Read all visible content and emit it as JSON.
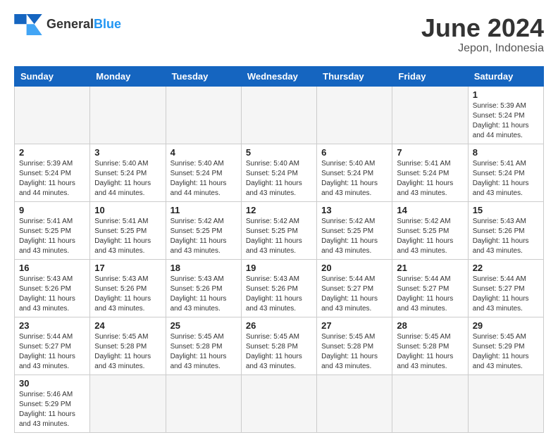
{
  "header": {
    "logo_general": "General",
    "logo_blue": "Blue",
    "month": "June 2024",
    "location": "Jepon, Indonesia"
  },
  "weekdays": [
    "Sunday",
    "Monday",
    "Tuesday",
    "Wednesday",
    "Thursday",
    "Friday",
    "Saturday"
  ],
  "weeks": [
    [
      {
        "day": "",
        "empty": true
      },
      {
        "day": "",
        "empty": true
      },
      {
        "day": "",
        "empty": true
      },
      {
        "day": "",
        "empty": true
      },
      {
        "day": "",
        "empty": true
      },
      {
        "day": "",
        "empty": true
      },
      {
        "day": "1",
        "info": "Sunrise: 5:39 AM\nSunset: 5:24 PM\nDaylight: 11 hours and 44 minutes."
      }
    ],
    [
      {
        "day": "2",
        "info": "Sunrise: 5:39 AM\nSunset: 5:24 PM\nDaylight: 11 hours and 44 minutes."
      },
      {
        "day": "3",
        "info": "Sunrise: 5:40 AM\nSunset: 5:24 PM\nDaylight: 11 hours and 44 minutes."
      },
      {
        "day": "4",
        "info": "Sunrise: 5:40 AM\nSunset: 5:24 PM\nDaylight: 11 hours and 44 minutes."
      },
      {
        "day": "5",
        "info": "Sunrise: 5:40 AM\nSunset: 5:24 PM\nDaylight: 11 hours and 43 minutes."
      },
      {
        "day": "6",
        "info": "Sunrise: 5:40 AM\nSunset: 5:24 PM\nDaylight: 11 hours and 43 minutes."
      },
      {
        "day": "7",
        "info": "Sunrise: 5:41 AM\nSunset: 5:24 PM\nDaylight: 11 hours and 43 minutes."
      },
      {
        "day": "8",
        "info": "Sunrise: 5:41 AM\nSunset: 5:24 PM\nDaylight: 11 hours and 43 minutes."
      }
    ],
    [
      {
        "day": "9",
        "info": "Sunrise: 5:41 AM\nSunset: 5:25 PM\nDaylight: 11 hours and 43 minutes."
      },
      {
        "day": "10",
        "info": "Sunrise: 5:41 AM\nSunset: 5:25 PM\nDaylight: 11 hours and 43 minutes."
      },
      {
        "day": "11",
        "info": "Sunrise: 5:42 AM\nSunset: 5:25 PM\nDaylight: 11 hours and 43 minutes."
      },
      {
        "day": "12",
        "info": "Sunrise: 5:42 AM\nSunset: 5:25 PM\nDaylight: 11 hours and 43 minutes."
      },
      {
        "day": "13",
        "info": "Sunrise: 5:42 AM\nSunset: 5:25 PM\nDaylight: 11 hours and 43 minutes."
      },
      {
        "day": "14",
        "info": "Sunrise: 5:42 AM\nSunset: 5:25 PM\nDaylight: 11 hours and 43 minutes."
      },
      {
        "day": "15",
        "info": "Sunrise: 5:43 AM\nSunset: 5:26 PM\nDaylight: 11 hours and 43 minutes."
      }
    ],
    [
      {
        "day": "16",
        "info": "Sunrise: 5:43 AM\nSunset: 5:26 PM\nDaylight: 11 hours and 43 minutes."
      },
      {
        "day": "17",
        "info": "Sunrise: 5:43 AM\nSunset: 5:26 PM\nDaylight: 11 hours and 43 minutes."
      },
      {
        "day": "18",
        "info": "Sunrise: 5:43 AM\nSunset: 5:26 PM\nDaylight: 11 hours and 43 minutes."
      },
      {
        "day": "19",
        "info": "Sunrise: 5:43 AM\nSunset: 5:26 PM\nDaylight: 11 hours and 43 minutes."
      },
      {
        "day": "20",
        "info": "Sunrise: 5:44 AM\nSunset: 5:27 PM\nDaylight: 11 hours and 43 minutes."
      },
      {
        "day": "21",
        "info": "Sunrise: 5:44 AM\nSunset: 5:27 PM\nDaylight: 11 hours and 43 minutes."
      },
      {
        "day": "22",
        "info": "Sunrise: 5:44 AM\nSunset: 5:27 PM\nDaylight: 11 hours and 43 minutes."
      }
    ],
    [
      {
        "day": "23",
        "info": "Sunrise: 5:44 AM\nSunset: 5:27 PM\nDaylight: 11 hours and 43 minutes."
      },
      {
        "day": "24",
        "info": "Sunrise: 5:45 AM\nSunset: 5:28 PM\nDaylight: 11 hours and 43 minutes."
      },
      {
        "day": "25",
        "info": "Sunrise: 5:45 AM\nSunset: 5:28 PM\nDaylight: 11 hours and 43 minutes."
      },
      {
        "day": "26",
        "info": "Sunrise: 5:45 AM\nSunset: 5:28 PM\nDaylight: 11 hours and 43 minutes."
      },
      {
        "day": "27",
        "info": "Sunrise: 5:45 AM\nSunset: 5:28 PM\nDaylight: 11 hours and 43 minutes."
      },
      {
        "day": "28",
        "info": "Sunrise: 5:45 AM\nSunset: 5:28 PM\nDaylight: 11 hours and 43 minutes."
      },
      {
        "day": "29",
        "info": "Sunrise: 5:45 AM\nSunset: 5:29 PM\nDaylight: 11 hours and 43 minutes."
      }
    ],
    [
      {
        "day": "30",
        "info": "Sunrise: 5:46 AM\nSunset: 5:29 PM\nDaylight: 11 hours and 43 minutes."
      },
      {
        "day": "",
        "empty": true
      },
      {
        "day": "",
        "empty": true
      },
      {
        "day": "",
        "empty": true
      },
      {
        "day": "",
        "empty": true
      },
      {
        "day": "",
        "empty": true
      },
      {
        "day": "",
        "empty": true
      }
    ]
  ]
}
